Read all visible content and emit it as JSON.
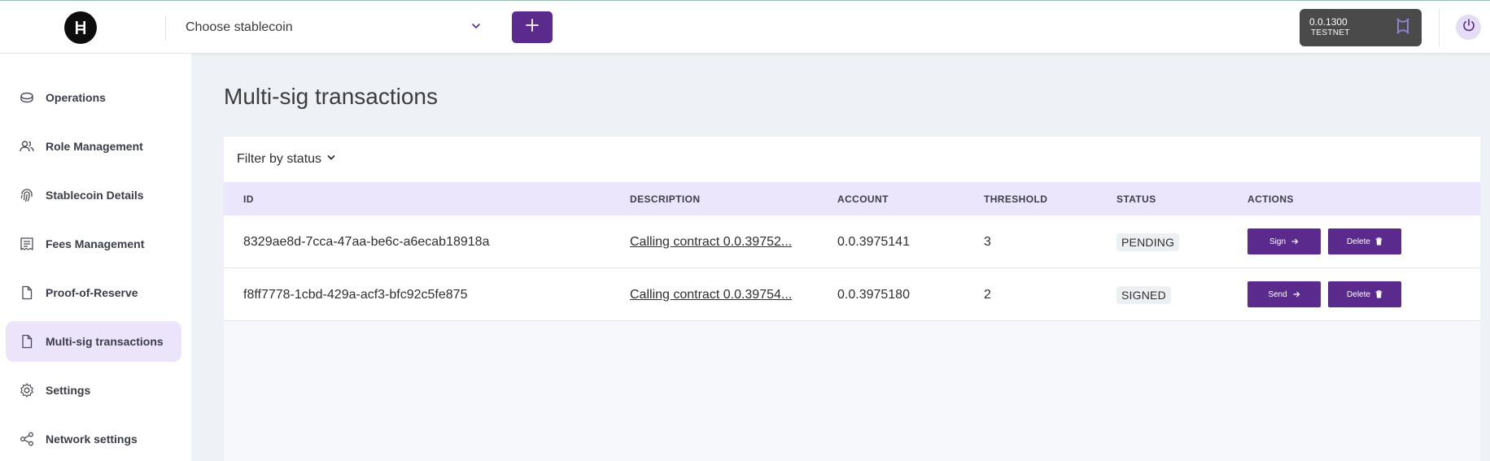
{
  "header": {
    "logo_icon": "hedera-logo",
    "coin_select": {
      "placeholder": "Choose stablecoin"
    },
    "add_button_icon": "plus-icon",
    "account": {
      "id": "0.0.1300",
      "network": "TESTNET",
      "wallet_icon": "wallet-icon"
    },
    "power_icon": "power-icon"
  },
  "sidebar": {
    "items": [
      {
        "label": "Operations",
        "icon": "coins-icon",
        "active": false
      },
      {
        "label": "Role Management",
        "icon": "users-icon",
        "active": false
      },
      {
        "label": "Stablecoin Details",
        "icon": "fingerprint-icon",
        "active": false
      },
      {
        "label": "Fees Management",
        "icon": "receipt-icon",
        "active": false
      },
      {
        "label": "Proof-of-Reserve",
        "icon": "file-icon",
        "active": false
      },
      {
        "label": "Multi-sig transactions",
        "icon": "file-icon",
        "active": true
      },
      {
        "label": "Settings",
        "icon": "gear-icon",
        "active": false
      },
      {
        "label": "Network settings",
        "icon": "share-icon",
        "active": false
      }
    ]
  },
  "main": {
    "title": "Multi-sig transactions",
    "filter_label": "Filter by status",
    "columns": [
      "ID",
      "DESCRIPTION",
      "ACCOUNT",
      "THRESHOLD",
      "STATUS",
      "ACTIONS"
    ],
    "rows": [
      {
        "id": "8329ae8d-7cca-47aa-be6c-a6ecab18918a",
        "description": "Calling contract 0.0.39752...",
        "account": "0.0.3975141",
        "threshold": "3",
        "status": "PENDING",
        "primary_action": "Sign",
        "delete_action": "Delete"
      },
      {
        "id": "f8ff7778-1cbd-429a-acf3-bfc92c5fe875",
        "description": "Calling contract 0.0.39754...",
        "account": "0.0.3975180",
        "threshold": "2",
        "status": "SIGNED",
        "primary_action": "Send",
        "delete_action": "Delete"
      }
    ]
  },
  "colors": {
    "accent": "#5a2a8c",
    "sidebar_active": "#ebe4fa",
    "table_header": "#ebe6fb",
    "page_bg": "#eef1f5"
  }
}
